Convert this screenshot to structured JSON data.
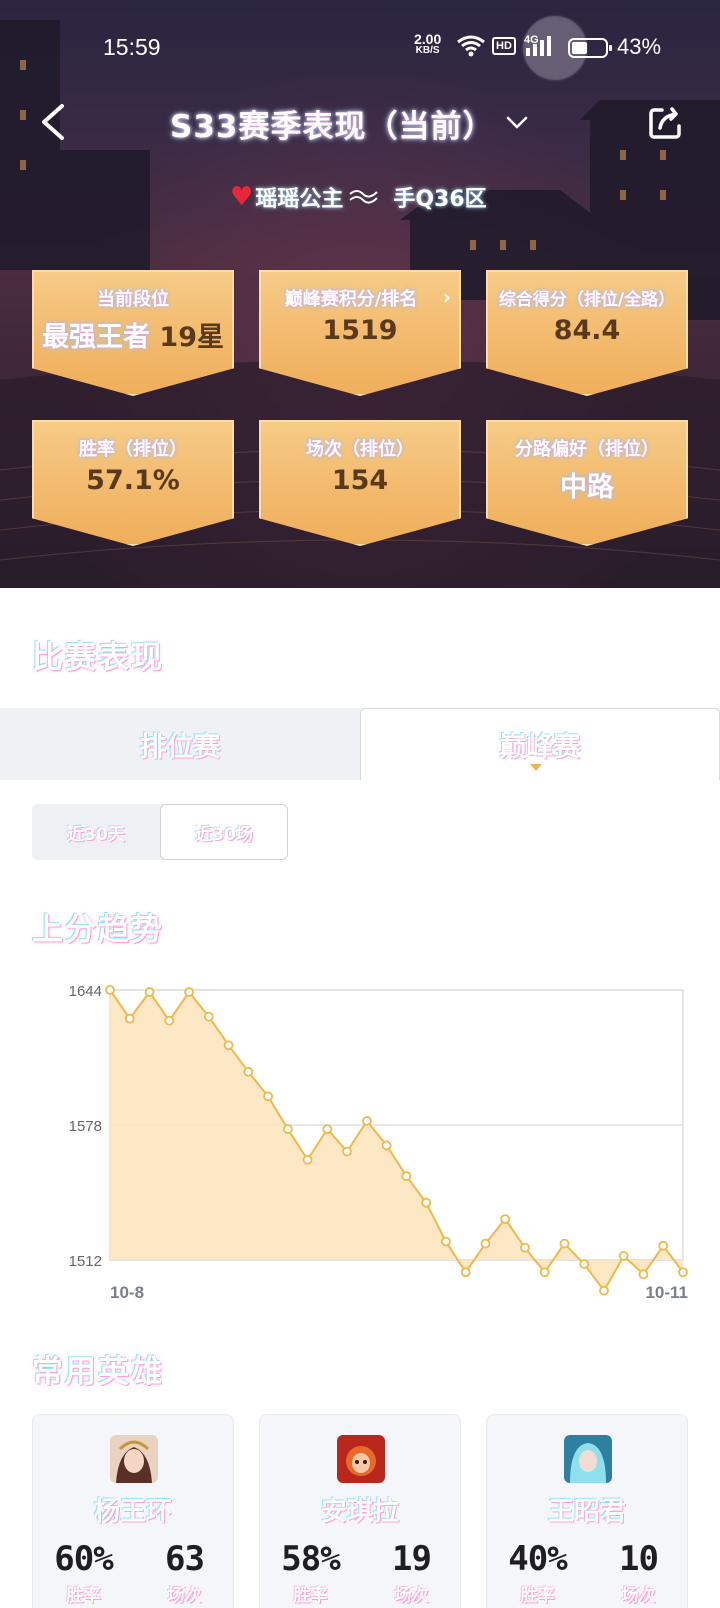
{
  "status_bar": {
    "time": "15:59",
    "net_speed_value": "2.00",
    "net_speed_unit": "KB/S",
    "hd_label": "HD",
    "network_label": "4G",
    "battery_text": "43%"
  },
  "header": {
    "title": "S33赛季表现（当前）",
    "player_name": "瑶瑶公主",
    "region": "手Q36区"
  },
  "stats": [
    {
      "label": "当前段位",
      "value": "最强王者 19星"
    },
    {
      "label": "巅峰赛积分/排名",
      "value": "1519"
    },
    {
      "label": "综合得分（排位/全路）",
      "value": "84.4"
    },
    {
      "label": "胜率（排位）",
      "value": "57.1%"
    },
    {
      "label": "场次（排位）",
      "value": "154"
    },
    {
      "label": "分路偏好（排位）",
      "value": "中路"
    }
  ],
  "rank_name": "最强王者",
  "rank_stars": "19星",
  "section_performance": "比赛表现",
  "tabs": [
    {
      "label": "排位赛",
      "active": false
    },
    {
      "label": "巅峰赛",
      "active": true
    }
  ],
  "segments": [
    {
      "label": "近30天",
      "active": false
    },
    {
      "label": "近30场",
      "active": true
    }
  ],
  "section_trend": "上分趋势",
  "chart_data": {
    "type": "area",
    "title": "上分趋势",
    "y_ticks": [
      "1644",
      "1578",
      "1512"
    ],
    "ylim": [
      1512,
      1644
    ],
    "x_start_label": "10-8",
    "x_end_label": "10-11",
    "grid": true,
    "series": [
      {
        "color": "#f0b84a",
        "values": [
          1644,
          1630,
          1643,
          1629,
          1643,
          1631,
          1617,
          1604,
          1592,
          1576,
          1561,
          1576,
          1565,
          1580,
          1568,
          1553,
          1540,
          1521,
          1506,
          1520,
          1532,
          1518,
          1506,
          1520,
          1510,
          1497,
          1514,
          1505,
          1519,
          1506
        ]
      }
    ]
  },
  "section_heroes": "常用英雄",
  "heroes": [
    {
      "name": "杨玉环",
      "win_rate": "60%",
      "games": "63",
      "win_label": "胜率",
      "games_label": "场次",
      "avatar_color": "#c9a98a"
    },
    {
      "name": "安琪拉",
      "win_rate": "58%",
      "games": "19",
      "win_label": "胜率",
      "games_label": "场次",
      "avatar_color": "#d2482e"
    },
    {
      "name": "王昭君",
      "win_rate": "40%",
      "games": "10",
      "win_label": "胜率",
      "games_label": "场次",
      "avatar_color": "#4ab3c8"
    }
  ]
}
